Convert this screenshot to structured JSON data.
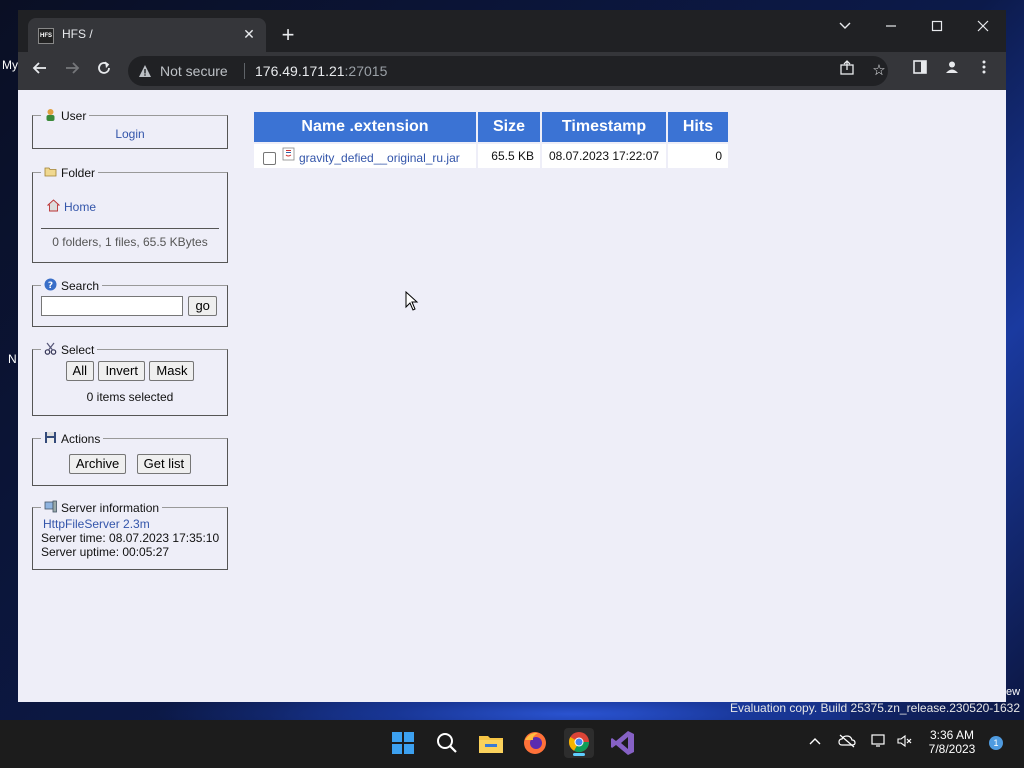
{
  "desktop": {
    "left_fragments": [
      "My",
      "N"
    ],
    "right_fragment": "ew",
    "evaluation_text": "Evaluation copy. Build 25375.zn_release.230520-1632"
  },
  "browser": {
    "tab_favicon_text": "HFS",
    "tab_title": "HFS /",
    "security_label": "Not secure",
    "url_host": "176.49.171.21",
    "url_port": ":27015"
  },
  "sidebar": {
    "user": {
      "legend": "User",
      "login_label": "Login"
    },
    "folder": {
      "legend": "Folder",
      "home_label": "Home",
      "summary": "0 folders, 1 files, 65.5 KBytes"
    },
    "search": {
      "legend": "Search",
      "go_label": "go",
      "input_value": ""
    },
    "select": {
      "legend": "Select",
      "all_label": "All",
      "invert_label": "Invert",
      "mask_label": "Mask",
      "status": "0 items selected"
    },
    "actions": {
      "legend": "Actions",
      "archive_label": "Archive",
      "get_list_label": "Get list"
    },
    "server_info": {
      "legend": "Server information",
      "server_name": "HttpFileServer 2.3m",
      "server_time": "Server time: 08.07.2023 17:35:10",
      "server_uptime": "Server uptime: 00:05:27"
    }
  },
  "file_table": {
    "headers": [
      "Name .extension",
      "Size",
      "Timestamp",
      "Hits"
    ],
    "rows": [
      {
        "name": "gravity_defied__original_ru.jar",
        "size": "65.5 KB",
        "timestamp": "08.07.2023 17:22:07",
        "hits": "0"
      }
    ]
  },
  "taskbar": {
    "apps": [
      "windows-start",
      "search",
      "file-explorer",
      "firefox",
      "chrome",
      "visual-studio"
    ],
    "active_app": "chrome",
    "clock_time": "3:36 AM",
    "clock_date": "7/8/2023",
    "notification_count": "1"
  },
  "colors": {
    "table_header": "#3b73d4",
    "page_background": "#eeeef8",
    "link": "#3355aa"
  }
}
